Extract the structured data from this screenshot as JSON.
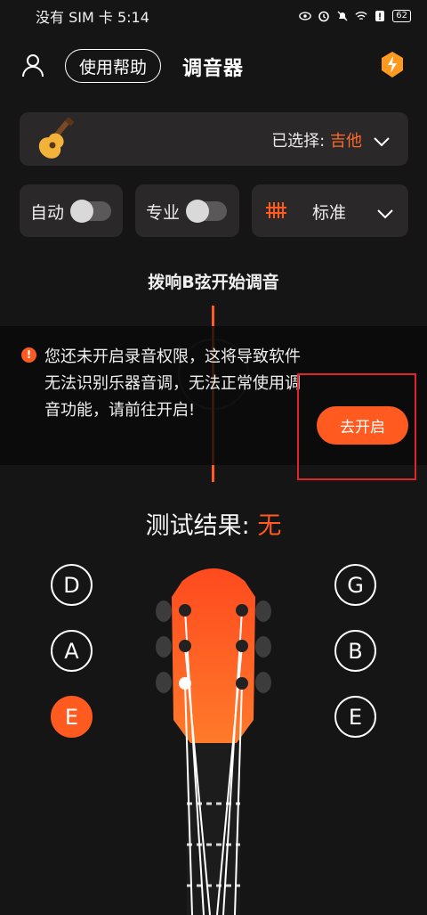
{
  "status_bar": {
    "carrier_time": "没有 SIM 卡 5:14",
    "battery": "62"
  },
  "header": {
    "help_label": "使用帮助",
    "title": "调音器"
  },
  "instrument": {
    "selected_prefix": "已选择:",
    "selected_value": "吉他"
  },
  "controls": {
    "auto_label": "自动",
    "auto_on": false,
    "pro_label": "专业",
    "pro_on": false,
    "tuning_label": "标准"
  },
  "hint": "拨响B弦开始调音",
  "permission": {
    "message": "您还未开启录音权限，这将导致软件 无法识别乐器音调，无法正常使用调音功能，请前往开启!",
    "button_label": "去开启"
  },
  "result": {
    "label": "测试结果:",
    "value": "无"
  },
  "strings": {
    "left": [
      "D",
      "A",
      "E"
    ],
    "right": [
      "G",
      "B",
      "E"
    ],
    "active": "left-3"
  },
  "colors": {
    "accent": "#ff5a1f",
    "card": "#2a2828",
    "background": "#151515",
    "highlight": "#e0262a"
  }
}
